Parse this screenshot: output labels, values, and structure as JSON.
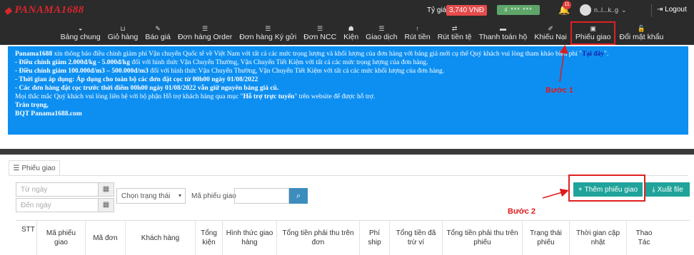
{
  "header": {
    "logo_text": "PANAMA1688",
    "rate_label": "Tỷ giá:",
    "rate_value": "3,740 VNĐ",
    "wallet_text": "₫ *** ***",
    "notifications_count": "11",
    "user_name": "n..l...k..g",
    "logout_label": "Logout"
  },
  "nav": {
    "items": [
      {
        "label": "Bảng chung",
        "icon": "dashboard-icon",
        "glyph": "◒"
      },
      {
        "label": "Giỏ hàng",
        "icon": "basket-icon",
        "glyph": "⊔"
      },
      {
        "label": "Báo giá",
        "icon": "magic-icon",
        "glyph": "✎"
      },
      {
        "label": "Đơn hàng Order",
        "icon": "list-icon",
        "glyph": "☰"
      },
      {
        "label": "Đơn hàng Ký gửi",
        "icon": "list-icon",
        "glyph": "☰"
      },
      {
        "label": "Đơn NCC",
        "icon": "list-icon",
        "glyph": "☰"
      },
      {
        "label": "Kiện",
        "icon": "users-icon",
        "glyph": "☗"
      },
      {
        "label": "Giao dịch",
        "icon": "list-icon",
        "glyph": "☰"
      },
      {
        "label": "Rút tiền",
        "icon": "arrow-up-icon",
        "glyph": "↑"
      },
      {
        "label": "Rút tiền tệ",
        "icon": "exchange-icon",
        "glyph": "⇄"
      },
      {
        "label": "Thanh toán hộ",
        "icon": "card-icon",
        "glyph": "▬"
      },
      {
        "label": "Khiếu Nại",
        "icon": "tag-icon",
        "glyph": "✐"
      },
      {
        "label": "Phiếu giao",
        "icon": "file-icon",
        "glyph": "▣"
      },
      {
        "label": "Đổi mật khẩu",
        "icon": "unlock-icon",
        "glyph": "🔓"
      }
    ],
    "active_index": 12
  },
  "notice": {
    "line1_pre": "Panama1688",
    "line1": " xin thông báo điều chỉnh giảm phí Vận chuyển Quốc tế về Việt Nam với tất cả các mức trọng lượng và khối lượng của đơn hàng với bảng giá mới cụ thể Quý khách vui lòng tham khảo biểu phí \"",
    "link": "Tại đây",
    "line1_post": "\".",
    "line2_pre": " - Điều chỉnh giảm 2.000đ/kg - 5.000đ/kg",
    "line2": " đối với hình thức Vận Chuyển Thường, Vận Chuyển Tiết Kiệm với tất cả các mức trọng lượng của đơn hàng.",
    "line3_pre": " - Điều chỉnh giảm 100.000đ/m3 – 500.000đ/m3",
    "line3": " đối với hình thức Vận Chuyển Thường, Vận Chuyển Tiết Kiệm với tất cả các mức khối lượng của đơn hàng.",
    "line4": " - Thời gian áp dụng: Áp dụng cho toàn bộ các đơn đặt cọc từ 00h00 ngày 01/08/2022",
    "line5": " - Các đơn hàng đặt cọc trước thời điểm 00h00 ngày 01/08/2022 vẫn giữ nguyên bảng giá cũ.",
    "line6_pre": " Mọi thắc mắc Quý khách vui lòng liên hệ với bộ phận Hỗ trợ khách hàng qua mục \"",
    "line6_bold": "Hỗ trợ trực tuyến",
    "line6_post": "\" trên website để được hỗ trợ.",
    "line7": "Trân trọng,",
    "line8": "BQT Panama1688.com"
  },
  "annotations": {
    "step1": "Bước 1",
    "step2": "Bước 2",
    "color": "#e01a1a"
  },
  "tab": {
    "label": "Phiếu giao"
  },
  "filters": {
    "from_placeholder": "Từ ngày",
    "to_placeholder": "Đến ngày",
    "status_select": "Chọn trạng thái",
    "code_label": "Mã phiếu giao",
    "code_value": ""
  },
  "actions": {
    "add_label": "Thêm phiếu giao",
    "export_label": "Xuất file"
  },
  "table": {
    "columns": [
      "STT",
      "Mã phiếu giao",
      "Mã đơn",
      "Khách hàng",
      "Tổng kiện",
      "Hình thức giao hàng",
      "Tổng tiền phải thu trên đơn",
      "Phí ship",
      "Tổng tiền đã trừ ví",
      "Tổng tiền phải thu trên phiếu",
      "Trạng thái phiếu",
      "Thời gian cập nhật",
      "Thao Tác"
    ]
  },
  "colors": {
    "topbar": "#2b2b2b",
    "notice_bg": "#0d8ff2",
    "teal_button": "#1fa39a",
    "search_button": "#3c8dbc"
  }
}
